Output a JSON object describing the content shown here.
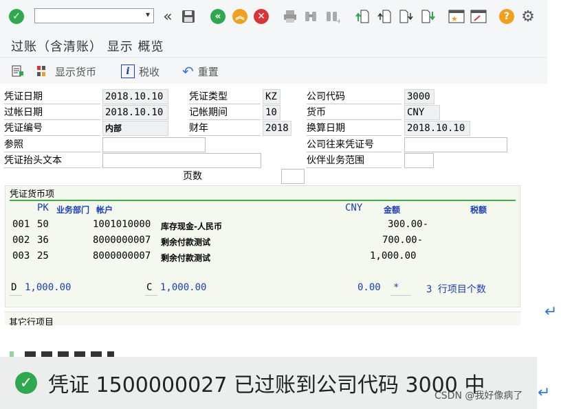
{
  "toolbar": {
    "icons": [
      "enter-icon",
      "command-field",
      "back-icon",
      "save-icon",
      "back-green-icon",
      "exit-icon",
      "cancel-icon",
      "print-icon",
      "find-icon",
      "find-next-icon",
      "first-page-icon",
      "prev-page-icon",
      "next-page-icon",
      "last-page-icon",
      "new-session-icon",
      "shortcut-icon",
      "help-icon",
      "settings-icon"
    ],
    "command_value": ""
  },
  "title": "过账（含清账） 显示 概览",
  "app_toolbar": {
    "display_currency": "显示货币",
    "tax": "税收",
    "reset": "重置"
  },
  "header": {
    "doc_date_label": "凭证日期",
    "doc_date": "2018.10.10",
    "doc_type_label": "凭证类型",
    "doc_type": "KZ",
    "company_code_label": "公司代码",
    "company_code": "3000",
    "posting_date_label": "过帐日期",
    "posting_date": "2018.10.10",
    "period_label": "记帐期间",
    "period": "10",
    "currency_label": "货币",
    "currency": "CNY",
    "doc_number_label": "凭证编号",
    "doc_number": "内部",
    "fiscal_year_label": "财年",
    "fiscal_year": "2018",
    "translation_date_label": "换算日期",
    "translation_date": "2018.10.10",
    "reference_label": "参照",
    "reference": "",
    "intercompany_label": "公司往来凭证号",
    "intercompany": "",
    "header_text_label": "凭证抬头文本",
    "header_text": "",
    "partner_ba_label": "伙伴业务范围",
    "partner_ba": "",
    "pages_label": "页数",
    "pages": ""
  },
  "items": {
    "group_title": "凭证货币项",
    "col_pk": "PK",
    "col_ba": "业务部门",
    "col_account": "帐户",
    "col_currency": "CNY",
    "col_amount": "金额",
    "col_tax": "税额",
    "rows": [
      {
        "line": "001",
        "pk": "50",
        "account": "1001010000",
        "name": "库存现金-人民币",
        "amount": "300.00-"
      },
      {
        "line": "002",
        "pk": "36",
        "account": "8000000007",
        "name": "剩余付款测试",
        "amount": "700.00-"
      },
      {
        "line": "003",
        "pk": "25",
        "account": "8000000007",
        "name": "剩余付款测试",
        "amount": "1,000.00"
      }
    ],
    "debit_label": "D",
    "debit": "1,000.00",
    "credit_label": "C",
    "credit": "1,000.00",
    "balance": "0.00",
    "balance_flag": "*",
    "line_count": "3 行项目个数"
  },
  "other_items_title": "其它行项目",
  "status": {
    "message": "凭证 1500000027 已过账到公司代码 3000 中"
  },
  "watermark": "CSDN @我好像病了",
  "colors": {
    "enter_green": "#2fa84f",
    "back_green": "#2fa84f",
    "exit_orange": "#f0a020",
    "cancel_red": "#d8343a",
    "help_orange": "#f0a020",
    "header_blue": "#1b3db8",
    "group_line_green": "#3cb043"
  }
}
